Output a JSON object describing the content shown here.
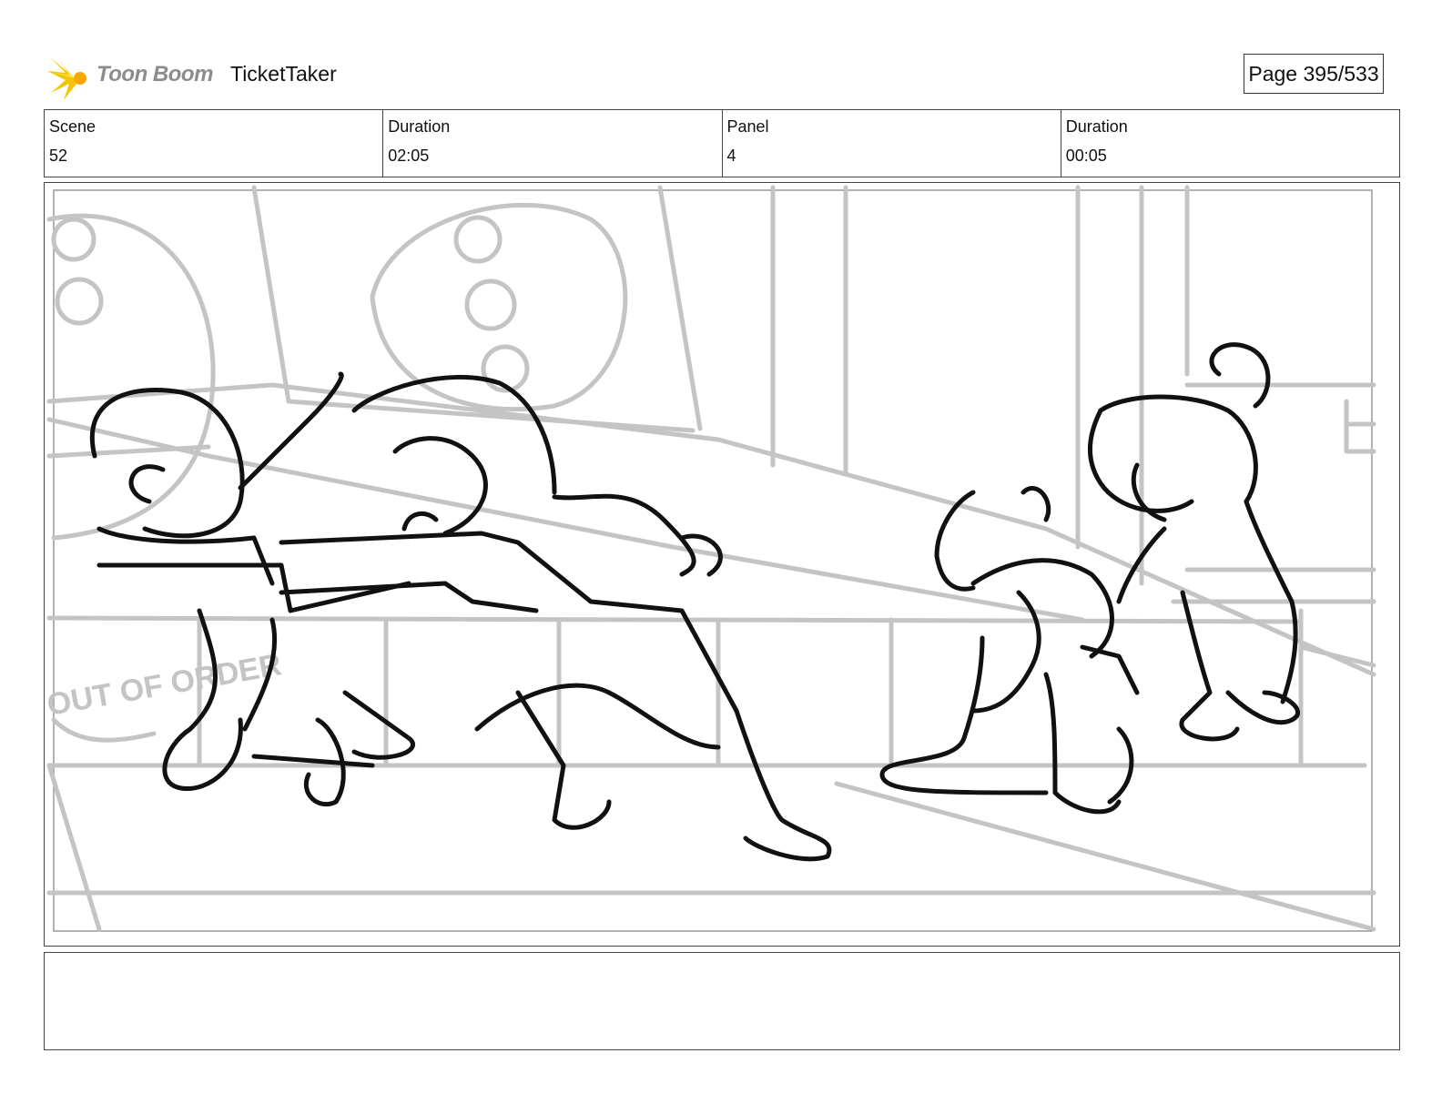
{
  "header": {
    "logo_text": "Toon Boom",
    "project_title": "TicketTaker",
    "page_label": "Page 395/533"
  },
  "info": {
    "scene_label": "Scene",
    "scene_value": "52",
    "scene_duration_label": "Duration",
    "scene_duration_value": "02:05",
    "panel_label": "Panel",
    "panel_value": "4",
    "panel_duration_label": "Duration",
    "panel_duration_value": "00:05"
  },
  "panel": {
    "sign_text": "OUT OF ORDER"
  },
  "notes": {
    "text": ""
  },
  "colors": {
    "sketch_line": "#111111",
    "background_line": "#c4c4c4",
    "logo_accent": "#f5c400"
  }
}
